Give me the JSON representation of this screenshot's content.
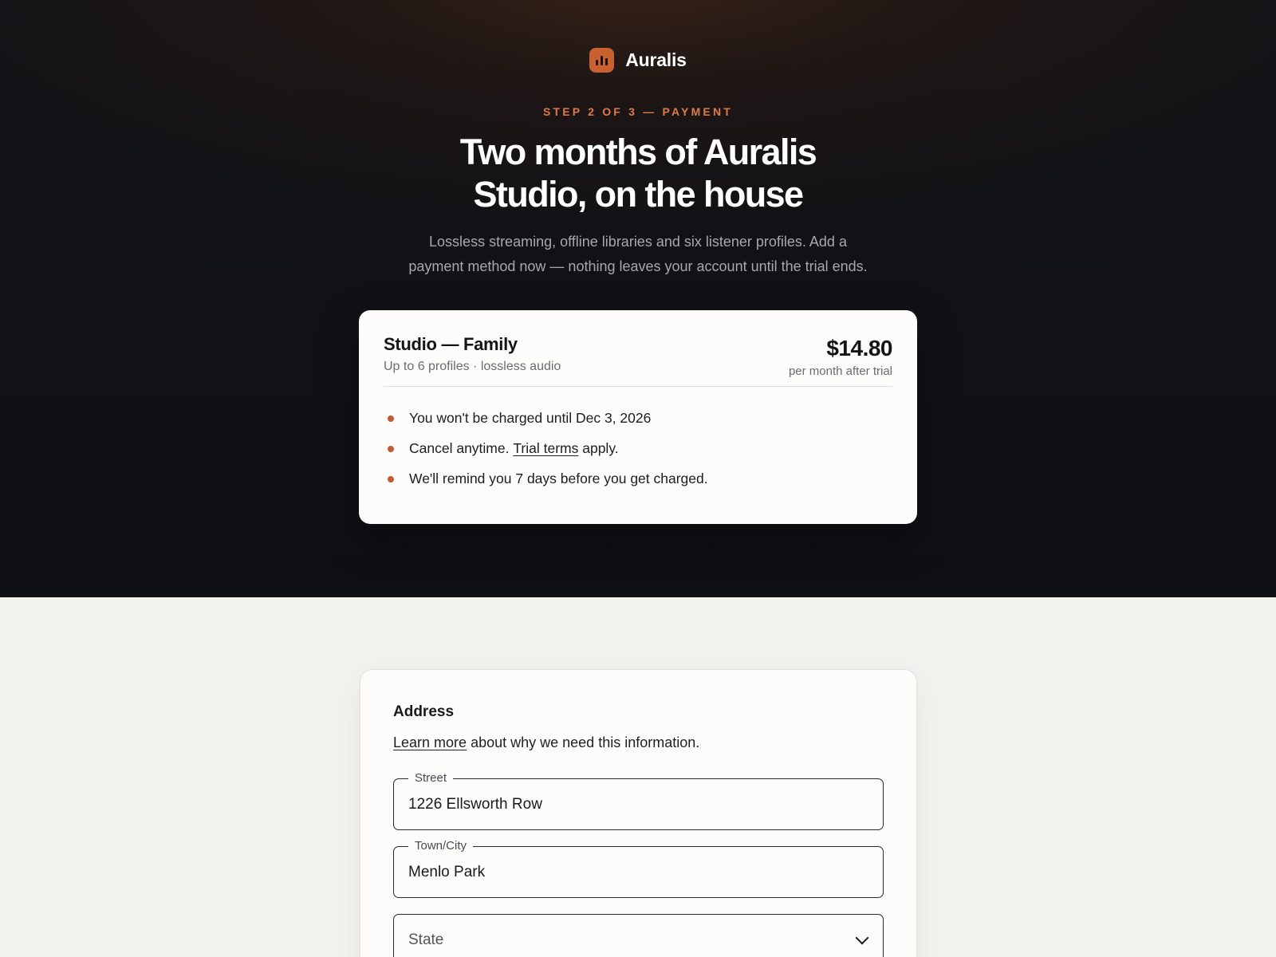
{
  "brand": {
    "name": "Auralis",
    "accent": "#c8612f",
    "logo_icon": "bar-chart-icon"
  },
  "hero": {
    "step": "STEP 2 OF 3 — PAYMENT",
    "title_line1": "Two months of Auralis",
    "title_line2": "Studio, on the house",
    "subtitle_line1": "Lossless streaming, offline libraries and six listener profiles. Add a",
    "subtitle_line2": "payment method now — nothing leaves your account until the trial ends."
  },
  "plan": {
    "name": "Studio — Family",
    "meta": "Up to 6 profiles · lossless audio",
    "price": "$14.80",
    "price_note": "per month after trial",
    "bullets": {
      "b1": "You won't be charged until Dec 3, 2026",
      "b2_before": "Cancel anytime.",
      "b2_link": "Trial terms",
      "b2_after": "apply.",
      "b3": "We'll remind you 7 days before you get charged."
    }
  },
  "address": {
    "title": "Address",
    "help_link": "Learn more",
    "help_text": "about why we need this information.",
    "street": {
      "label": "Street",
      "value": "1226 Ellsworth Row"
    },
    "city": {
      "label": "Town/City",
      "value": "Menlo Park"
    },
    "state": {
      "placeholder": "State"
    }
  }
}
